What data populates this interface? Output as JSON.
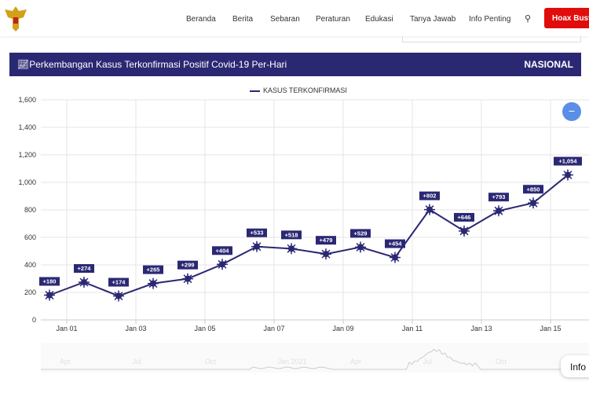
{
  "nav": {
    "items": [
      "Beranda",
      "Berita",
      "Sebaran",
      "Peraturan",
      "Edukasi",
      "Tanya Jawab",
      "Info Penting"
    ],
    "hoax_label": "Hoax Buster",
    "search_icon": "search-icon"
  },
  "header": {
    "title": "Perkembangan Kasus Terkonfirmasi Positif Covid-19 Per-Hari",
    "region": "NASIONAL",
    "icon": "chart-line-icon",
    "bg": "#2b2873"
  },
  "chart_data": {
    "type": "line",
    "series": [
      {
        "name": "KASUS TERKONFIRMASI",
        "color": "#2b2873",
        "x": [
          "2020-12-31",
          "2021-01-01",
          "2021-01-02",
          "2021-01-03",
          "2021-01-04",
          "2021-01-05",
          "2021-01-06",
          "2021-01-07",
          "2021-01-08",
          "2021-01-09",
          "2021-01-10",
          "2021-01-11",
          "2021-01-12",
          "2021-01-13",
          "2021-01-14",
          "2021-01-15"
        ],
        "values": [
          180,
          274,
          174,
          265,
          299,
          404,
          533,
          518,
          479,
          529,
          454,
          802,
          646,
          793,
          850,
          1054
        ],
        "labels": [
          "+180",
          "+274",
          "+174",
          "+265",
          "+299",
          "+404",
          "+533",
          "+518",
          "+479",
          "+529",
          "+454",
          "+802",
          "+646",
          "+793",
          "+850",
          "+1,054"
        ]
      }
    ],
    "yticks": [
      "0",
      "200",
      "400",
      "600",
      "800",
      "1,000",
      "1,200",
      "1,400",
      "1,600"
    ],
    "ylim": [
      0,
      1600
    ],
    "xticks": [
      "Jan 01",
      "Jan 03",
      "Jan 05",
      "Jan 07",
      "Jan 09",
      "Jan 11",
      "Jan 13",
      "Jan 15"
    ],
    "grid": true,
    "legend": "top-center",
    "navigator_labels": [
      "Apr",
      "Jul",
      "Oct",
      "Jan 2021",
      "Apr",
      "Jul",
      "Oct",
      "Ja"
    ]
  },
  "zoom_out_label": "−",
  "info_label": "Info"
}
